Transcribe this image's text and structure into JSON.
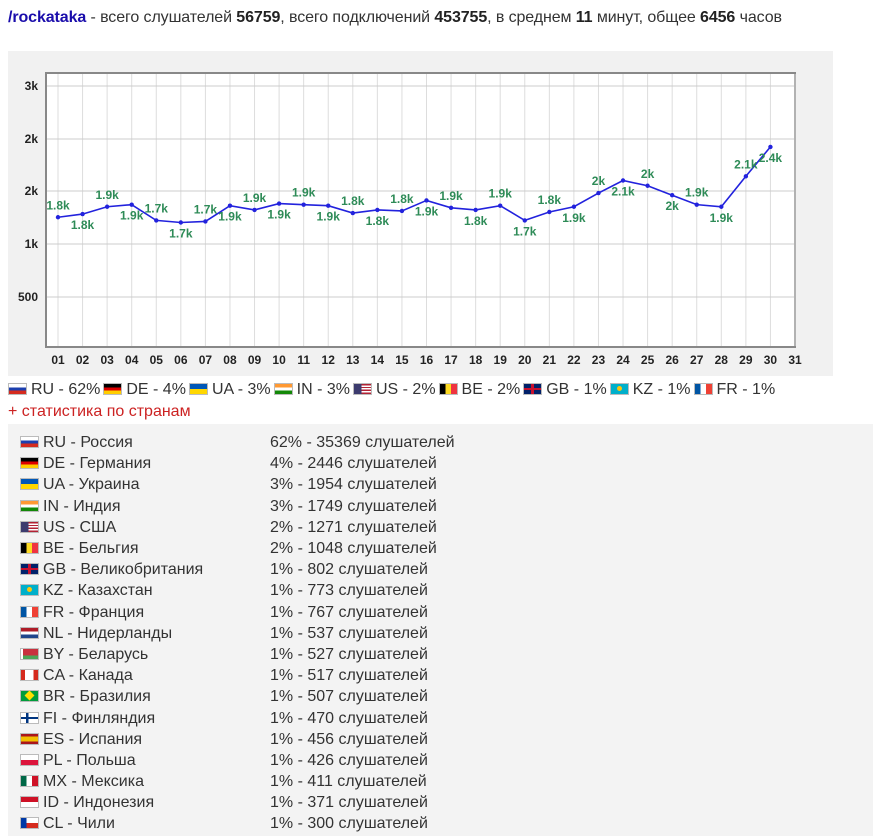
{
  "header": {
    "stream": "/rockataka",
    "t1": " - всего слушателей ",
    "listeners": "56759",
    "t2": ", всего подключений ",
    "connections": "453755",
    "t3": ", в среднем ",
    "avg": "11",
    "t4": " минут, общее ",
    "hours": "6456",
    "t5": " часов"
  },
  "chart_data": {
    "type": "line",
    "categories": [
      "01",
      "02",
      "03",
      "04",
      "05",
      "06",
      "07",
      "08",
      "09",
      "10",
      "11",
      "12",
      "13",
      "14",
      "15",
      "16",
      "17",
      "18",
      "19",
      "20",
      "21",
      "22",
      "23",
      "24",
      "25",
      "26",
      "27",
      "28",
      "29",
      "30",
      "31"
    ],
    "series": [
      {
        "values": [
          1750,
          1780,
          1850,
          1870,
          1720,
          1700,
          1710,
          1860,
          1820,
          1880,
          1870,
          1860,
          1790,
          1820,
          1810,
          1910,
          1840,
          1820,
          1860,
          1720,
          1800,
          1850,
          1980,
          2100,
          2050,
          1960,
          1870,
          1850,
          2140,
          2420,
          null
        ]
      }
    ],
    "data_labels": [
      "1.8k",
      "1.8k",
      "1.9k",
      "1.9k",
      "1.7k",
      "1.7k",
      "1.7k",
      "1.9k",
      "1.9k",
      "1.9k",
      "1.9k",
      "1.9k",
      "1.8k",
      "1.8k",
      "1.8k",
      "1.9k",
      "1.9k",
      "1.8k",
      "1.9k",
      "1.7k",
      "1.8k",
      "1.9k",
      "2k",
      "2.1k",
      "2k",
      "2k",
      "1.9k",
      "1.9k",
      "2.1k",
      "2.4k"
    ],
    "y_ticks": [
      {
        "value": 3000,
        "label": "3k"
      },
      {
        "value": 2500,
        "label": "2k"
      },
      {
        "value": 2000,
        "label": "2k"
      },
      {
        "value": 1000,
        "label": "1k"
      },
      {
        "value": 500,
        "label": "500"
      }
    ],
    "ylim": [
      0,
      3000
    ],
    "grid": true,
    "line_color": "#2222dd",
    "label_color": "#2e8b57"
  },
  "summary": [
    {
      "code": "RU",
      "text": "RU - 62%"
    },
    {
      "code": "DE",
      "text": "DE - 4%"
    },
    {
      "code": "UA",
      "text": "UA - 3%"
    },
    {
      "code": "IN",
      "text": "IN - 3%"
    },
    {
      "code": "US",
      "text": "US - 2%"
    },
    {
      "code": "BE",
      "text": "BE - 2%"
    },
    {
      "code": "GB",
      "text": "GB - 1%"
    },
    {
      "code": "KZ",
      "text": "KZ - 1%"
    },
    {
      "code": "FR",
      "text": "FR - 1%"
    }
  ],
  "stats_toggle": "+ статистика по странам",
  "countries": [
    {
      "code": "RU",
      "name": "RU - Россия",
      "stat": "62% - 35369 слушателей"
    },
    {
      "code": "DE",
      "name": "DE - Германия",
      "stat": "4% - 2446 слушателей"
    },
    {
      "code": "UA",
      "name": "UA - Украина",
      "stat": "3% - 1954 слушателей"
    },
    {
      "code": "IN",
      "name": "IN - Индия",
      "stat": "3% - 1749 слушателей"
    },
    {
      "code": "US",
      "name": "US - США",
      "stat": "2% - 1271 слушателей"
    },
    {
      "code": "BE",
      "name": "BE - Бельгия",
      "stat": "2% - 1048 слушателей"
    },
    {
      "code": "GB",
      "name": "GB - Великобритания",
      "stat": "1% - 802 слушателей"
    },
    {
      "code": "KZ",
      "name": "KZ - Казахстан",
      "stat": "1% - 773 слушателей"
    },
    {
      "code": "FR",
      "name": "FR - Франция",
      "stat": "1% - 767 слушателей"
    },
    {
      "code": "NL",
      "name": "NL - Нидерланды",
      "stat": "1% - 537 слушателей"
    },
    {
      "code": "BY",
      "name": "BY - Беларусь",
      "stat": "1% - 527 слушателей"
    },
    {
      "code": "CA",
      "name": "CA - Канада",
      "stat": "1% - 517 слушателей"
    },
    {
      "code": "BR",
      "name": "BR - Бразилия",
      "stat": "1% - 507 слушателей"
    },
    {
      "code": "FI",
      "name": "FI - Финляндия",
      "stat": "1% - 470 слушателей"
    },
    {
      "code": "ES",
      "name": "ES - Испания",
      "stat": "1% - 456 слушателей"
    },
    {
      "code": "PL",
      "name": "PL - Польша",
      "stat": "1% - 426 слушателей"
    },
    {
      "code": "MX",
      "name": "MX - Мексика",
      "stat": "1% - 411 слушателей"
    },
    {
      "code": "ID",
      "name": "ID - Индонезия",
      "stat": "1% - 371 слушателей"
    },
    {
      "code": "CL",
      "name": "CL - Чили",
      "stat": "1% - 300 слушателей"
    }
  ]
}
